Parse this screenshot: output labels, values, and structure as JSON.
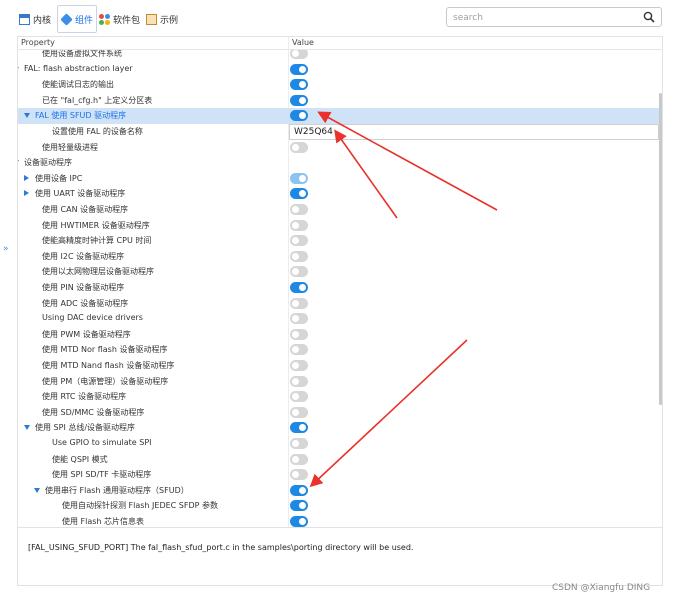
{
  "tabs": [
    {
      "label": "内核",
      "icon": "kernel-icon"
    },
    {
      "label": "组件",
      "icon": "component-icon",
      "active": true
    },
    {
      "label": "软件包",
      "icon": "package-icon"
    },
    {
      "label": "示例",
      "icon": "example-icon"
    }
  ],
  "search": {
    "placeholder": "search"
  },
  "table": {
    "col_property": "Property",
    "col_value": "Value",
    "rows": [
      {
        "label": "使用设备虚拟文件系统",
        "toggle": "off"
      },
      {
        "label": "FAL: flash abstraction layer",
        "toggle": "on",
        "expander": "down"
      },
      {
        "label": "使能调试日志的输出",
        "toggle": "on"
      },
      {
        "label": "已在 \"fal_cfg.h\" 上定义分区表",
        "toggle": "on"
      },
      {
        "label": "FAL 使用 SFUD 驱动程序",
        "toggle": "on",
        "expander": "down",
        "selected": true
      },
      {
        "label": "设置使用 FAL 的设备名称",
        "value": "W25Q64"
      },
      {
        "label": "使用轻量级进程",
        "toggle": "off"
      },
      {
        "label": "设备驱动程序",
        "expander": "down"
      },
      {
        "label": "使用设备 IPC",
        "toggle": "dim",
        "expander": "right"
      },
      {
        "label": "使用 UART 设备驱动程序",
        "toggle": "on",
        "expander": "right"
      },
      {
        "label": "使用 CAN 设备驱动程序",
        "toggle": "off"
      },
      {
        "label": "使用 HWTIMER 设备驱动程序",
        "toggle": "off"
      },
      {
        "label": "使能高精度时钟计算 CPU 时间",
        "toggle": "off"
      },
      {
        "label": "使用 I2C 设备驱动程序",
        "toggle": "off"
      },
      {
        "label": "使用以太网物理层设备驱动程序",
        "toggle": "off"
      },
      {
        "label": "使用 PIN 设备驱动程序",
        "toggle": "on"
      },
      {
        "label": "使用 ADC 设备驱动程序",
        "toggle": "off"
      },
      {
        "label": "Using DAC device drivers",
        "toggle": "off"
      },
      {
        "label": "使用 PWM 设备驱动程序",
        "toggle": "off"
      },
      {
        "label": "使用 MTD Nor flash 设备驱动程序",
        "toggle": "off"
      },
      {
        "label": "使用 MTD Nand flash 设备驱动程序",
        "toggle": "off"
      },
      {
        "label": "使用 PM（电源管理）设备驱动程序",
        "toggle": "off"
      },
      {
        "label": "使用 RTC 设备驱动程序",
        "toggle": "off"
      },
      {
        "label": "使用 SD/MMC 设备驱动程序",
        "toggle": "off"
      },
      {
        "label": "使用 SPI 总线/设备驱动程序",
        "toggle": "on",
        "expander": "down"
      },
      {
        "label": "Use GPIO to simulate SPI",
        "toggle": "off"
      },
      {
        "label": "使能 QSPI 模式",
        "toggle": "off"
      },
      {
        "label": "使用 SPI SD/TF 卡驱动程序",
        "toggle": "off"
      },
      {
        "label": "使用串行 Flash 通用驱动程序（SFUD）",
        "toggle": "on",
        "expander": "down"
      },
      {
        "label": "使用自动探针探测 Flash JEDEC SFDP 参数",
        "toggle": "on"
      },
      {
        "label": "使用 Flash 芯片信息表",
        "toggle": "on"
      }
    ]
  },
  "description": "[FAL_USING_SFUD_PORT] The fal_flash_sfud_port.c in the samples\\porting directory will be used.",
  "watermark": "CSDN @Xiangfu DING",
  "side_arrow": "»",
  "colors": {
    "accent": "#1e88e5",
    "selected_row": "#cfe2f6",
    "annotation_arrow": "#e8322b"
  }
}
